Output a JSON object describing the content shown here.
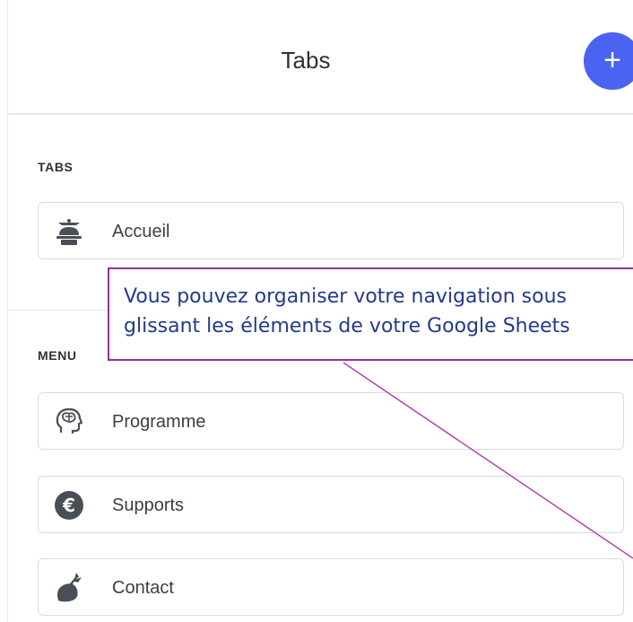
{
  "header": {
    "title": "Tabs",
    "add_label": "+"
  },
  "tabs_section": {
    "label": "TABS",
    "items": [
      {
        "label": "Accueil",
        "icon": "waiter-cloche-icon"
      }
    ]
  },
  "menu_section": {
    "label": "MENU",
    "items": [
      {
        "label": "Programme",
        "icon": "head-brain-icon"
      },
      {
        "label": "Supports",
        "icon": "euro-icon"
      },
      {
        "label": "Contact",
        "icon": "sprout-icon"
      }
    ]
  },
  "callout": {
    "line1": "Vous pouvez organiser votre navigation sous",
    "line2": "glissant les éléments de votre Google Sheets"
  },
  "colors": {
    "accent": "#4a63f0",
    "callout_border": "#9b2f99",
    "callout_text": "#24398a"
  }
}
